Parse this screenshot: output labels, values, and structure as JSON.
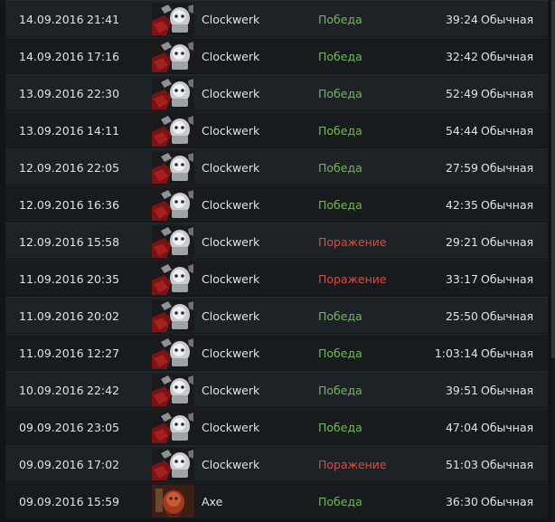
{
  "colors": {
    "win": "#6fbb4f",
    "loss": "#e8463a"
  },
  "icons": {
    "Clockwerk": "clockwerk-hero-icon",
    "Axe": "axe-hero-icon"
  },
  "matches": [
    {
      "date": "14.09.2016",
      "time": "21:41",
      "hero": "Clockwerk",
      "result": "Победа",
      "outcome": "win",
      "duration": "39:24",
      "mode": "Обычная"
    },
    {
      "date": "14.09.2016",
      "time": "17:16",
      "hero": "Clockwerk",
      "result": "Победа",
      "outcome": "win",
      "duration": "32:42",
      "mode": "Обычная"
    },
    {
      "date": "13.09.2016",
      "time": "22:30",
      "hero": "Clockwerk",
      "result": "Победа",
      "outcome": "win",
      "duration": "52:49",
      "mode": "Обычная"
    },
    {
      "date": "13.09.2016",
      "time": "14:11",
      "hero": "Clockwerk",
      "result": "Победа",
      "outcome": "win",
      "duration": "54:44",
      "mode": "Обычная"
    },
    {
      "date": "12.09.2016",
      "time": "22:05",
      "hero": "Clockwerk",
      "result": "Победа",
      "outcome": "win",
      "duration": "27:59",
      "mode": "Обычная"
    },
    {
      "date": "12.09.2016",
      "time": "16:36",
      "hero": "Clockwerk",
      "result": "Победа",
      "outcome": "win",
      "duration": "42:35",
      "mode": "Обычная"
    },
    {
      "date": "12.09.2016",
      "time": "15:58",
      "hero": "Clockwerk",
      "result": "Поражение",
      "outcome": "loss",
      "duration": "29:21",
      "mode": "Обычная"
    },
    {
      "date": "11.09.2016",
      "time": "20:35",
      "hero": "Clockwerk",
      "result": "Поражение",
      "outcome": "loss",
      "duration": "33:17",
      "mode": "Обычная"
    },
    {
      "date": "11.09.2016",
      "time": "20:02",
      "hero": "Clockwerk",
      "result": "Победа",
      "outcome": "win",
      "duration": "25:50",
      "mode": "Обычная"
    },
    {
      "date": "11.09.2016",
      "time": "12:27",
      "hero": "Clockwerk",
      "result": "Победа",
      "outcome": "win",
      "duration": "1:03:14",
      "mode": "Обычная"
    },
    {
      "date": "10.09.2016",
      "time": "22:42",
      "hero": "Clockwerk",
      "result": "Победа",
      "outcome": "win",
      "duration": "39:51",
      "mode": "Обычная"
    },
    {
      "date": "09.09.2016",
      "time": "23:05",
      "hero": "Clockwerk",
      "result": "Победа",
      "outcome": "win",
      "duration": "47:04",
      "mode": "Обычная"
    },
    {
      "date": "09.09.2016",
      "time": "17:02",
      "hero": "Clockwerk",
      "result": "Поражение",
      "outcome": "loss",
      "duration": "51:03",
      "mode": "Обычная"
    },
    {
      "date": "09.09.2016",
      "time": "15:59",
      "hero": "Axe",
      "result": "Победа",
      "outcome": "win",
      "duration": "36:30",
      "mode": "Обычная"
    }
  ]
}
